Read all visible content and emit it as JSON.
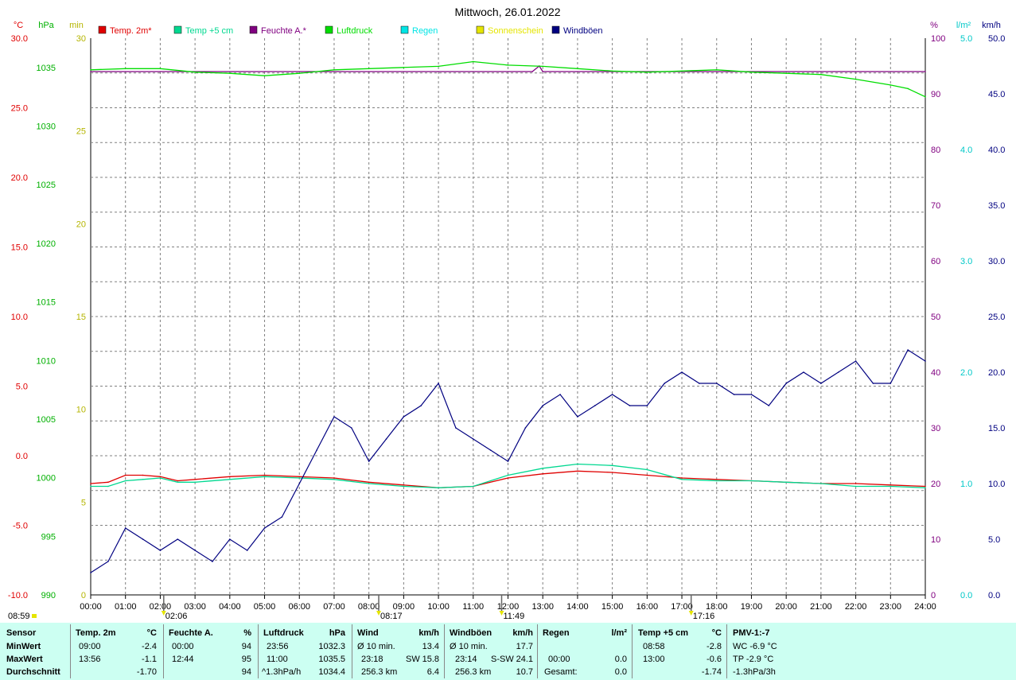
{
  "title": "Mittwoch, 26.01.2022",
  "colors": {
    "temp2m": "#e00000",
    "temp5cm": "#00d890",
    "feuchte": "#800080",
    "luftdruck": "#00dd00",
    "regen": "#00e5e5",
    "sonne": "#e5e500",
    "windboeen": "#000080",
    "grid": "#808080",
    "summary_bg": "#ccfff2"
  },
  "legend": [
    {
      "label": "Temp. 2m*",
      "color": "#e00000"
    },
    {
      "label": "Temp +5 cm",
      "color": "#00d890"
    },
    {
      "label": "Feuchte A.*",
      "color": "#800080"
    },
    {
      "label": "Luftdruck",
      "color": "#00dd00"
    },
    {
      "label": "Regen",
      "color": "#00e5e5"
    },
    {
      "label": "Sonnenschein",
      "color": "#e5e500"
    },
    {
      "label": "Windböen",
      "color": "#000080"
    }
  ],
  "axis_units": {
    "temp": "°C",
    "pressure": "hPa",
    "sun": "min",
    "humidity": "%",
    "rain": "l/m²",
    "wind": "km/h"
  },
  "markers": [
    {
      "time": "02:06",
      "label": "02:06",
      "hour": 2.1
    },
    {
      "time": "08:17",
      "label": "08:17",
      "hour": 8.283
    },
    {
      "time": "11:49",
      "label": "11:49",
      "hour": 11.817
    },
    {
      "time": "17:16",
      "label": "17:16",
      "hour": 17.267
    }
  ],
  "sunrise_label": "08:59",
  "chart_data": {
    "type": "line",
    "title": "Mittwoch, 26.01.2022",
    "x": {
      "label": "",
      "range": [
        0,
        24
      ],
      "ticks": [
        "00:00",
        "01:00",
        "02:00",
        "03:00",
        "04:00",
        "05:00",
        "06:00",
        "07:00",
        "08:00",
        "09:00",
        "10:00",
        "11:00",
        "12:00",
        "13:00",
        "14:00",
        "15:00",
        "16:00",
        "17:00",
        "18:00",
        "19:00",
        "20:00",
        "21:00",
        "22:00",
        "23:00",
        "24:00"
      ]
    },
    "axes": {
      "temp": {
        "unit": "°C",
        "range": [
          -10,
          30
        ],
        "ticks": [
          "-10.0",
          "-5.0",
          "0.0",
          "5.0",
          "10.0",
          "15.0",
          "20.0",
          "25.0",
          "30.0"
        ]
      },
      "pressure": {
        "unit": "hPa",
        "range": [
          990,
          1037.5
        ],
        "ticks": [
          "990",
          "995",
          "1000",
          "1005",
          "1010",
          "1015",
          "1020",
          "1025",
          "1030",
          "1035"
        ]
      },
      "sun": {
        "unit": "min",
        "range": [
          0,
          30
        ],
        "ticks": [
          "0",
          "5",
          "10",
          "15",
          "20",
          "25",
          "30"
        ]
      },
      "humidity": {
        "unit": "%",
        "range": [
          0,
          100
        ],
        "ticks": [
          "0",
          "10",
          "20",
          "30",
          "40",
          "50",
          "60",
          "70",
          "80",
          "90",
          "100"
        ]
      },
      "rain": {
        "unit": "l/m²",
        "range": [
          0,
          5
        ],
        "ticks": [
          "0.0",
          "1.0",
          "2.0",
          "3.0",
          "4.0",
          "5.0"
        ]
      },
      "wind": {
        "unit": "km/h",
        "range": [
          0,
          50
        ],
        "ticks": [
          "0.0",
          "5.0",
          "10.0",
          "15.0",
          "20.0",
          "25.0",
          "30.0",
          "35.0",
          "40.0",
          "45.0",
          "50.0"
        ]
      }
    },
    "grid": true,
    "legend_position": "top",
    "series": [
      {
        "name": "Temp. 2m*",
        "axis": "temp",
        "x": [
          0,
          0.5,
          1,
          1.5,
          2,
          2.5,
          3,
          4,
          5,
          6,
          7,
          8,
          9,
          10,
          11,
          12,
          13,
          14,
          15,
          16,
          17,
          18,
          19,
          20,
          21,
          22,
          23,
          24
        ],
        "values": [
          -2.0,
          -1.9,
          -1.4,
          -1.4,
          -1.5,
          -1.8,
          -1.7,
          -1.5,
          -1.4,
          -1.5,
          -1.6,
          -1.9,
          -2.1,
          -2.3,
          -2.2,
          -1.6,
          -1.3,
          -1.1,
          -1.2,
          -1.4,
          -1.6,
          -1.7,
          -1.8,
          -1.9,
          -2.0,
          -2.0,
          -2.1,
          -2.2
        ]
      },
      {
        "name": "Temp +5 cm",
        "axis": "temp",
        "x": [
          0,
          0.5,
          1,
          1.5,
          2,
          2.5,
          3,
          4,
          5,
          6,
          7,
          8,
          9,
          10,
          11,
          12,
          13,
          14,
          15,
          16,
          17,
          18,
          19,
          20,
          21,
          22,
          23,
          24
        ],
        "values": [
          -2.2,
          -2.2,
          -1.8,
          -1.7,
          -1.6,
          -1.9,
          -1.9,
          -1.7,
          -1.5,
          -1.6,
          -1.7,
          -2.0,
          -2.2,
          -2.3,
          -2.2,
          -1.4,
          -0.9,
          -0.6,
          -0.7,
          -1.0,
          -1.7,
          -1.8,
          -1.8,
          -1.9,
          -2.0,
          -2.2,
          -2.2,
          -2.3
        ]
      },
      {
        "name": "Feuchte A.*",
        "axis": "humidity",
        "x": [
          0,
          12.7,
          12.9,
          13,
          24
        ],
        "values": [
          94,
          94,
          95,
          94,
          94
        ]
      },
      {
        "name": "Luftdruck",
        "axis": "pressure",
        "x": [
          0,
          1,
          2,
          3,
          4,
          5,
          6,
          7,
          8,
          9,
          10,
          11,
          12,
          13,
          14,
          15,
          16,
          17,
          18,
          19,
          20,
          21,
          22,
          23,
          23.5,
          24
        ],
        "values": [
          1034.8,
          1034.9,
          1034.9,
          1034.6,
          1034.5,
          1034.3,
          1034.5,
          1034.8,
          1034.9,
          1035.0,
          1035.1,
          1035.5,
          1035.2,
          1035.1,
          1034.9,
          1034.7,
          1034.6,
          1034.7,
          1034.8,
          1034.6,
          1034.5,
          1034.4,
          1034.0,
          1033.5,
          1033.2,
          1032.5
        ]
      },
      {
        "name": "Windböen",
        "axis": "wind",
        "x": [
          0,
          0.5,
          1,
          1.5,
          2,
          2.5,
          3,
          3.5,
          4,
          4.5,
          5,
          5.5,
          6,
          6.5,
          7,
          7.5,
          8,
          8.5,
          9,
          9.5,
          10,
          10.5,
          11,
          11.5,
          12,
          12.5,
          13,
          13.5,
          14,
          14.5,
          15,
          15.5,
          16,
          16.5,
          17,
          17.5,
          18,
          18.5,
          19,
          19.5,
          20,
          20.5,
          21,
          21.5,
          22,
          22.5,
          23,
          23.5,
          24
        ],
        "values": [
          2,
          3,
          6,
          5,
          4,
          5,
          4,
          3,
          5,
          4,
          6,
          7,
          10,
          13,
          16,
          15,
          12,
          14,
          16,
          17,
          19,
          15,
          14,
          13,
          12,
          15,
          17,
          18,
          16,
          17,
          18,
          17,
          17,
          19,
          20,
          19,
          19,
          18,
          18,
          17,
          19,
          20,
          19,
          20,
          21,
          19,
          19,
          22,
          21
        ]
      }
    ]
  },
  "summary": {
    "header": {
      "sensor": "Sensor",
      "minwert": "MinWert",
      "maxwert": "MaxWert",
      "durchschnitt": "Durchschnitt"
    },
    "temp2m": {
      "title": "Temp. 2m",
      "unit": "°C",
      "min_time": "09:00",
      "min_val": "-2.4",
      "max_time": "13:56",
      "max_val": "-1.1",
      "avg": "-1.70"
    },
    "feuchte": {
      "title": "Feuchte A.",
      "unit": "%",
      "min_time": "00:00",
      "min_val": "94",
      "max_time": "12:44",
      "max_val": "95",
      "avg": "94"
    },
    "luftdruck": {
      "title": "Luftdruck",
      "unit": "hPa",
      "min_time": "23:56",
      "min_val": "1032.3",
      "max_time": "11:00",
      "max_val": "1035.5",
      "trend": "^1.3hPa/h",
      "avg": "1034.4"
    },
    "wind": {
      "title": "Wind",
      "unit": "km/h",
      "r1_label": "Ø 10 min.",
      "r1_val": "13.4",
      "r2_time": "23:18",
      "r2_dir": "SW",
      "r2_val": "15.8",
      "r3_dist": "256.3 km",
      "r3_val": "6.4"
    },
    "windboeen": {
      "title": "Windböen",
      "unit": "km/h",
      "r1_label": "Ø 10 min.",
      "r1_val": "17.7",
      "r2_time": "23:14",
      "r2_dir": "S-SW",
      "r2_val": "24.1",
      "r3_dist": "256.3 km",
      "r3_val": "10.7"
    },
    "regen": {
      "title": "Regen",
      "unit": "l/m²",
      "r2_time": "00:00",
      "r2_val": "0.0",
      "r3_label": "Gesamt:",
      "r3_val": "0.0"
    },
    "temp5cm": {
      "title": "Temp +5 cm",
      "unit": "°C",
      "min_time": "08:58",
      "min_val": "-2.8",
      "max_time": "13:00",
      "max_val": "-0.6",
      "avg": "-1.74"
    },
    "pmv": {
      "title": "PMV-1:-7",
      "r1": "WC -6.9 °C",
      "r2": "TP -2.9 °C",
      "r3": "-1.3hPa/3h"
    }
  }
}
